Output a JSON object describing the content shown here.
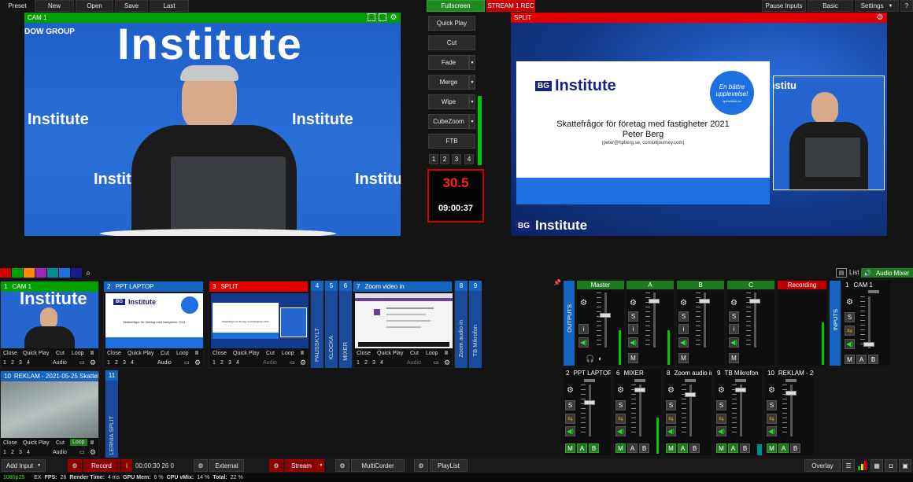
{
  "toolbar": {
    "preset": "Preset",
    "new": "New",
    "open": "Open",
    "save": "Save",
    "last": "Last",
    "fullscreen": "Fullscreen",
    "stream_rec": "STREAM 1 REC",
    "pause_inputs": "Pause Inputs",
    "basic": "Basic",
    "settings": "Settings",
    "help": "?"
  },
  "preview": {
    "title": "CAM 1",
    "bg_words": [
      "Institute",
      "Institute",
      "Institute",
      "Institute",
      "Institute"
    ],
    "group_text": "DOW GROUP"
  },
  "output": {
    "title": "SPLIT",
    "slide_brand": "Institute",
    "slide_badge": "En bättre upplevelse!",
    "slide_badge_url": "hpinstitute.se",
    "slide_title": "Skattefrågor för företag med fastigheter 2021",
    "slide_presenter": "Peter Berg",
    "slide_contact": "(peter@hpberg.se, consultjourney.com)",
    "footer_brand": "Institute",
    "cam_word": "Institu"
  },
  "transitions": [
    "Quick Play",
    "Cut",
    "Fade",
    "Merge",
    "Wipe",
    "CubeZoom",
    "FTB"
  ],
  "transition_numbers": [
    "1",
    "2",
    "3",
    "4"
  ],
  "clock": {
    "value": "30.5",
    "time": "09:00:37"
  },
  "colors": {
    "green": "#00a000",
    "red": "#d00000",
    "blue": "#1565c0",
    "accent": "#2e7d32"
  },
  "swatches": [
    "#d00000",
    "#00a000",
    "#ff8c00",
    "#9c27b0",
    "#008c8c",
    "#1e6fe0",
    "#1a1a8c"
  ],
  "audio_header": {
    "list": "List",
    "mixer": "Audio Mixer"
  },
  "inputs": [
    {
      "num": "1",
      "name": "CAM 1",
      "color": "#00a000"
    },
    {
      "num": "2",
      "name": "PPT LAPTOP",
      "color": "#1565c0"
    },
    {
      "num": "3",
      "name": "SPLIT",
      "color": "#e00000"
    },
    {
      "num": "7",
      "name": "Zoom video in",
      "color": "#1565c0"
    },
    {
      "num": "10",
      "name": "REKLAM - 2021-05-25 Skattefrågor.m",
      "color": "#1565c0"
    }
  ],
  "input_controls": {
    "close": "Close",
    "quick_play": "Quick Play",
    "cut": "Cut",
    "loop": "Loop",
    "audio": "Audio",
    "pause": "II",
    "nums": [
      "1",
      "2",
      "3",
      "4"
    ]
  },
  "vertical_inputs": [
    {
      "num": "4",
      "label": "PAUSSKYLT"
    },
    {
      "num": "5",
      "label": "KLOCKA"
    },
    {
      "num": "6",
      "label": "MIXER"
    },
    {
      "num": "8",
      "label": "Zoom audio in"
    },
    {
      "num": "9",
      "label": "TB Mikrofon"
    },
    {
      "num": "11",
      "label": "LERNIA SPLIT"
    }
  ],
  "mixer": {
    "outputs_label": "OUTPUTS",
    "inputs_label": "INPUTS",
    "buses": [
      "Master",
      "A",
      "B",
      "C"
    ],
    "recording": "Recording",
    "s": "S",
    "i": "i",
    "m": "M",
    "a": "A",
    "b": "B",
    "cam": {
      "num": "1",
      "name": "CAM 1"
    },
    "channels": [
      {
        "num": "2",
        "name": "PPT LAPTOP"
      },
      {
        "num": "6",
        "name": "MIXER"
      },
      {
        "num": "8",
        "name": "Zoom audio in"
      },
      {
        "num": "9",
        "name": "TB Mikrofon"
      },
      {
        "num": "10",
        "name": "REKLAM - 202"
      }
    ]
  },
  "bottom": {
    "add_input": "Add Input",
    "record": "Record",
    "record_i": "i",
    "timecode": "00:00:30 26 0",
    "external": "External",
    "stream": "Stream",
    "multicorder": "MultiCorder",
    "playlist": "PlayList",
    "overlay": "Overlay"
  },
  "status": {
    "resolution": "1080p25",
    "ex": "EX",
    "fps_label": "FPS:",
    "fps": "26",
    "render_label": "Render Time:",
    "render": "4 ms",
    "gpu_label": "GPU Mem:",
    "gpu": "6 %",
    "cpu_label": "CPU vMix:",
    "cpu": "14 %",
    "total_label": "Total:",
    "total": "22 %"
  }
}
